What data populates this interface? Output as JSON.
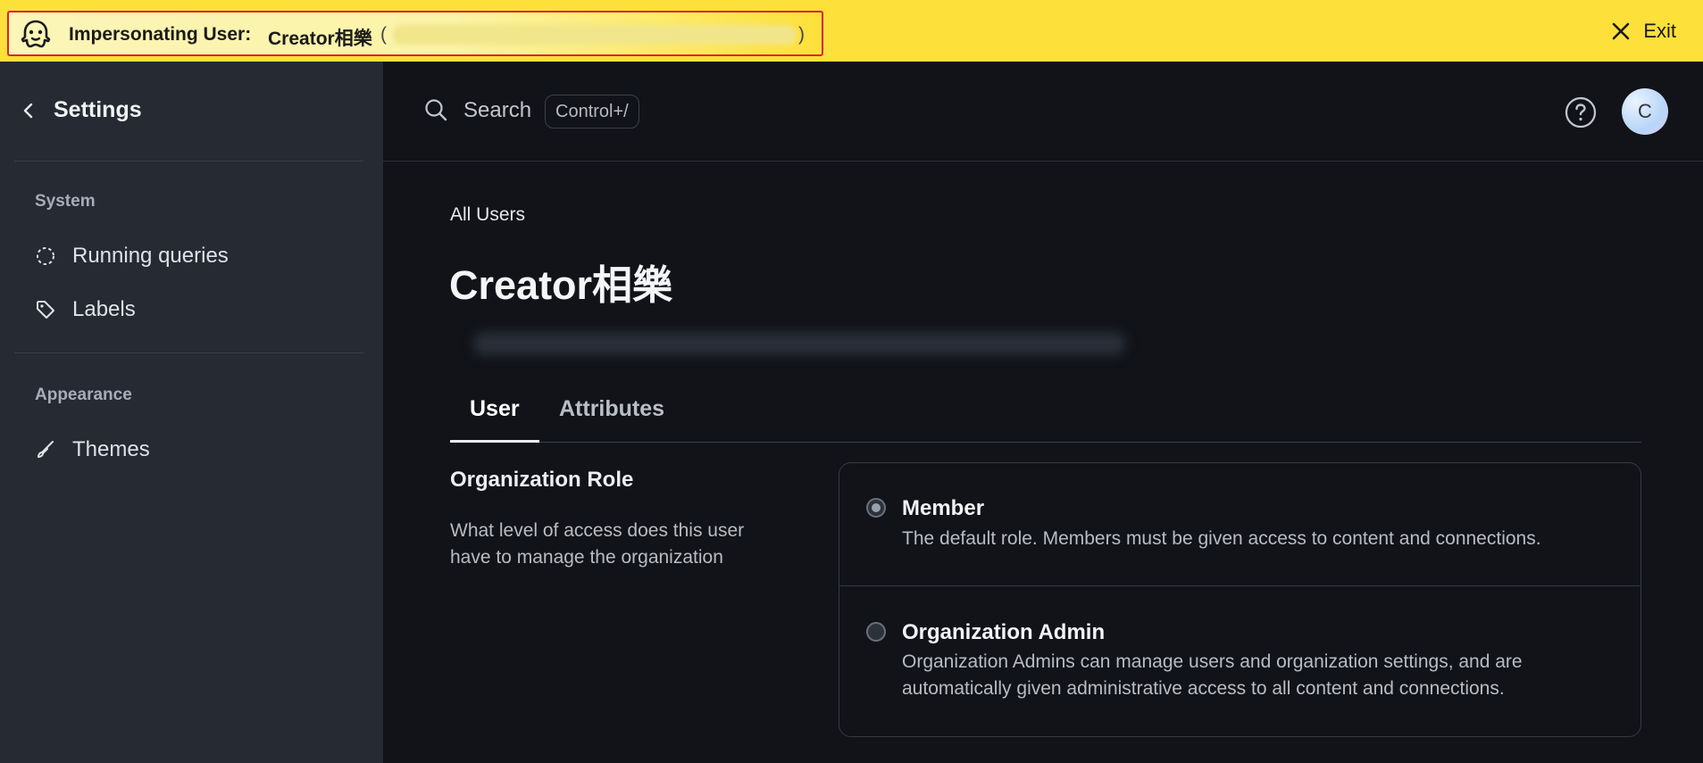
{
  "banner": {
    "label": "Impersonating User:",
    "user_name": "Creator相樂",
    "paren_open": "(",
    "paren_close": ")",
    "exit_label": "Exit",
    "icon": "ghost-icon",
    "colors": {
      "background": "#fde03a",
      "highlight_border": "#e02222"
    }
  },
  "sidebar": {
    "back_icon": "chevron-left-icon",
    "title": "Settings",
    "sections": [
      {
        "label": "System",
        "items": [
          {
            "label": "Running queries",
            "icon": "dashed-circle-icon"
          },
          {
            "label": "Labels",
            "icon": "tag-icon"
          }
        ]
      },
      {
        "label": "Appearance",
        "items": [
          {
            "label": "Themes",
            "icon": "brush-icon"
          }
        ]
      }
    ]
  },
  "topbar": {
    "search_label": "Search",
    "search_shortcut": "Control+/",
    "help_icon": "question-circle-icon",
    "avatar_initial": "C"
  },
  "main": {
    "breadcrumb": "All Users",
    "title": "Creator相樂",
    "tabs": [
      {
        "label": "User",
        "active": true
      },
      {
        "label": "Attributes",
        "active": false
      }
    ],
    "org_role": {
      "title": "Organization Role",
      "description": "What level of access does this user have to manage the organization",
      "options": [
        {
          "name": "Member",
          "description": "The default role. Members must be given access to content and connections.",
          "selected": true
        },
        {
          "name": "Organization Admin",
          "description": "Organization Admins can manage users and organization settings, and are automatically given administrative access to all content and connections.",
          "selected": false
        }
      ]
    }
  }
}
